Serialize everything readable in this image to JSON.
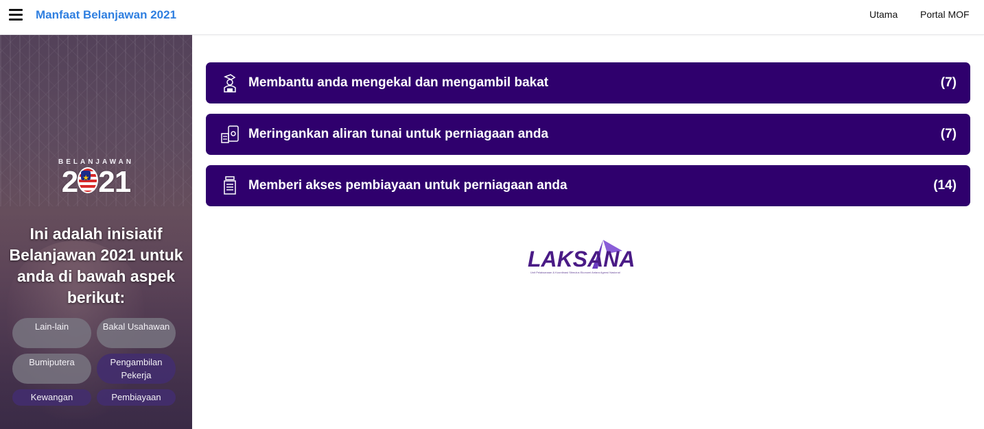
{
  "header": {
    "title": "Manfaat Belanjawan 2021",
    "nav": [
      "Utama",
      "Portal MOF"
    ]
  },
  "sidebar": {
    "logo_word": "BELANJAWAN",
    "logo_year_a": "2",
    "logo_year_b": "21",
    "heading": "Ini adalah inisiatif Belanjawan 2021 untuk anda di bawah aspek berikut:",
    "chips": [
      "Lain-lain",
      "Bakal Usahawan",
      "Bumiputera",
      "Pengambilan Pekerja",
      "Kewangan",
      "Pembiayaan"
    ]
  },
  "categories": [
    {
      "icon": "worker-icon",
      "title": "Membantu anda mengekal dan mengambil bakat",
      "count": "(7)"
    },
    {
      "icon": "cash-flow-icon",
      "title": "Meringankan aliran tunai untuk perniagaan anda",
      "count": "(7)"
    },
    {
      "icon": "financing-jar-icon",
      "title": "Memberi akses pembiayaan untuk perniagaan anda",
      "count": "(14)"
    }
  ],
  "footer_logo": {
    "name": "LAKSANA",
    "tagline": "Unit Pelaksanaan & Koordinasi Stimulus Ekonomi Antara Agensi Nasional"
  },
  "colors": {
    "title_blue": "#2f7fe0",
    "card_purple": "#2f006d",
    "logo_purple": "#4a1b86"
  }
}
